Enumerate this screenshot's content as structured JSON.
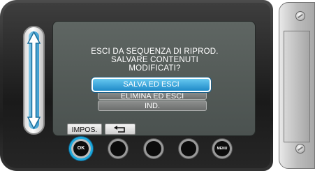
{
  "dialog": {
    "message_lines": [
      "ESCI DA SEQUENZA DI RIPROD.",
      "SALVARE CONTENUTI",
      "MODIFICATI?"
    ],
    "options": [
      {
        "label": "SALVA ED ESCI",
        "selected": true
      },
      {
        "label": "ELIMINA ED ESCI",
        "selected": false
      },
      {
        "label": "IND.",
        "selected": false
      }
    ]
  },
  "softkeys": {
    "settings_label": "IMPOS.",
    "back_icon": "return-arrow-icon"
  },
  "hardware_buttons": [
    {
      "name": "ok",
      "label": "OK",
      "highlighted": true
    },
    {
      "name": "button-2",
      "label": "",
      "highlighted": false
    },
    {
      "name": "button-3",
      "label": "",
      "highlighted": false
    },
    {
      "name": "button-4",
      "label": "",
      "highlighted": false
    },
    {
      "name": "menu",
      "label": "MENU",
      "highlighted": false
    }
  ],
  "colors": {
    "accent": "#1ea8dc",
    "selected_option": "#2f9ed8",
    "screen": "#5a615e"
  }
}
